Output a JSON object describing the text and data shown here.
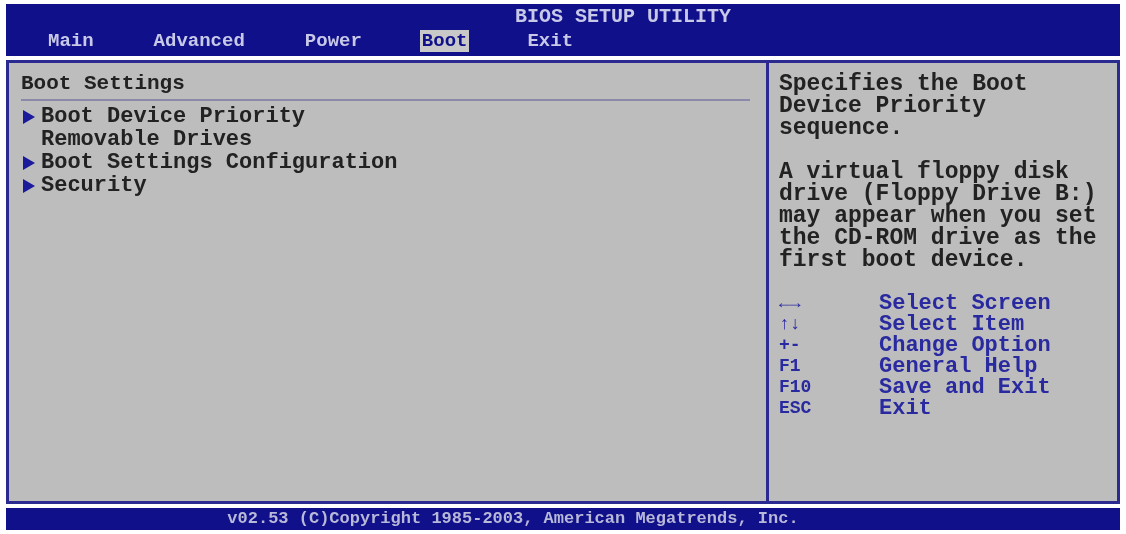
{
  "header": {
    "title": "BIOS SETUP UTILITY",
    "tabs": [
      {
        "label": "Main",
        "selected": false
      },
      {
        "label": "Advanced",
        "selected": false
      },
      {
        "label": "Power",
        "selected": false
      },
      {
        "label": "Boot",
        "selected": true
      },
      {
        "label": "Exit",
        "selected": false
      }
    ]
  },
  "main": {
    "title": "Boot Settings",
    "items": [
      {
        "label": "Boot Device Priority",
        "submenu": true
      },
      {
        "label": "Removable Drives",
        "submenu": false
      },
      {
        "label": "Boot Settings Configuration",
        "submenu": true
      },
      {
        "label": "Security",
        "submenu": true
      }
    ]
  },
  "help": {
    "paragraphs": [
      "Specifies the Boot Device Priority sequence.",
      "A virtual floppy disk drive (Floppy Drive B:) may appear when you set the CD-ROM drive as the first boot device."
    ],
    "keys": [
      {
        "key": "←→",
        "action": "Select Screen"
      },
      {
        "key": "↑↓",
        "action": "Select Item"
      },
      {
        "key": "+-",
        "action": "Change Option"
      },
      {
        "key": "F1",
        "action": "General Help"
      },
      {
        "key": "F10",
        "action": "Save and Exit"
      },
      {
        "key": "ESC",
        "action": "Exit"
      }
    ]
  },
  "footer": {
    "text": "v02.53 (C)Copyright 1985-2003, American Megatrends, Inc."
  }
}
